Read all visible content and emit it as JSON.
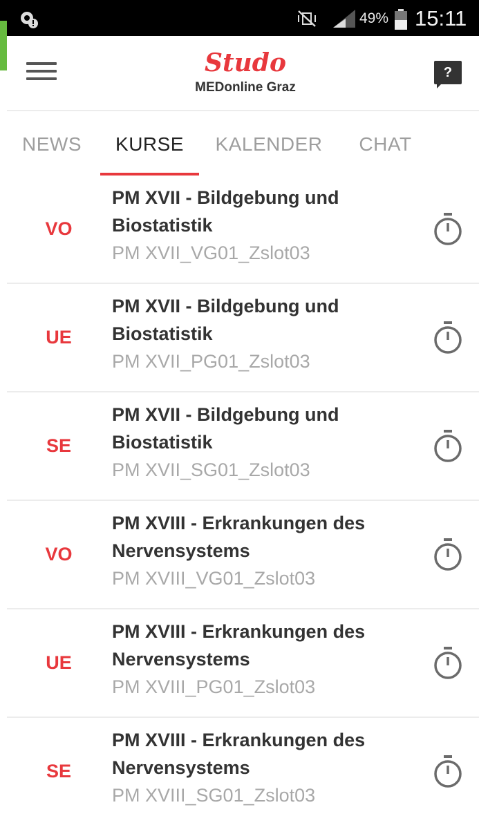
{
  "status_bar": {
    "battery_percent": "49%",
    "time": "15:11"
  },
  "header": {
    "logo": "Studo",
    "subtitle": "MEDonline Graz",
    "help_label": "?"
  },
  "tabs": [
    {
      "label": "NEWS",
      "active": false
    },
    {
      "label": "KURSE",
      "active": true
    },
    {
      "label": "KALENDER",
      "active": false
    },
    {
      "label": "CHAT",
      "active": false
    }
  ],
  "courses": [
    {
      "type": "VO",
      "title_line1": "PM XVII - Bildgebung und",
      "title_line2": "Biostatistik",
      "code": "PM XVII_VG01_Zslot03"
    },
    {
      "type": "UE",
      "title_line1": "PM XVII - Bildgebung und",
      "title_line2": "Biostatistik",
      "code": "PM XVII_PG01_Zslot03"
    },
    {
      "type": "SE",
      "title_line1": "PM XVII - Bildgebung und",
      "title_line2": "Biostatistik",
      "code": "PM XVII_SG01_Zslot03"
    },
    {
      "type": "VO",
      "title_line1": "PM XVIII - Erkrankungen des",
      "title_line2": "Nervensystems",
      "code": "PM XVIII_VG01_Zslot03"
    },
    {
      "type": "UE",
      "title_line1": "PM XVIII - Erkrankungen des",
      "title_line2": "Nervensystems",
      "code": "PM XVIII_PG01_Zslot03"
    },
    {
      "type": "SE",
      "title_line1": "PM XVIII - Erkrankungen des",
      "title_line2": "Nervensystems",
      "code": "PM XVIII_SG01_Zslot03"
    }
  ],
  "colors": {
    "accent": "#e8383d",
    "status_bar": "#000000",
    "muted_text": "#a8a8a8"
  },
  "icons": {
    "status_left": "settings-alert-icon",
    "mute": "vibrate-mute-icon",
    "signal": "signal-icon",
    "battery": "battery-icon",
    "menu": "hamburger-menu-icon",
    "help": "help-chat-icon",
    "course_action": "stopwatch-icon"
  }
}
